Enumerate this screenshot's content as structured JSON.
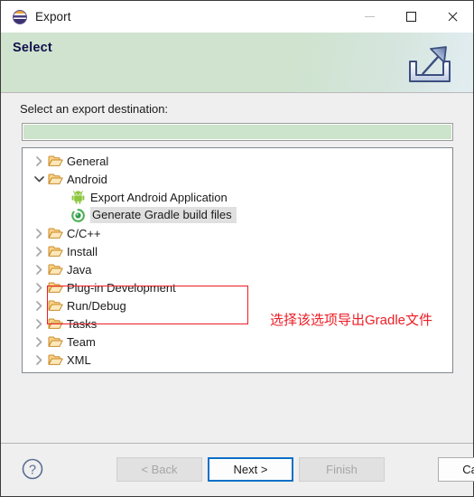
{
  "window": {
    "title": "Export",
    "app_icon": "eclipse-icon",
    "controls": {
      "minimize": "minimize-icon",
      "maximize": "maximize-icon",
      "close": "close-icon"
    }
  },
  "banner": {
    "title": "Select",
    "icon": "export-arrow-icon",
    "background_color": "#cfe3cf"
  },
  "main": {
    "prompt": "Select an export destination:",
    "filter": {
      "value": "",
      "placeholder": "",
      "background_color": "#cce3cc"
    }
  },
  "tree": {
    "items": [
      {
        "label": "General",
        "level": 1,
        "twisty": "chevron-right-icon",
        "icon": "folder-icon",
        "selected": false
      },
      {
        "label": "Android",
        "level": 1,
        "twisty": "chevron-down-icon",
        "icon": "folder-icon",
        "selected": false
      },
      {
        "label": "Export Android Application",
        "level": 2,
        "twisty": "none",
        "icon": "android-icon",
        "selected": false
      },
      {
        "label": "Generate Gradle build files",
        "level": 2,
        "twisty": "none",
        "icon": "gradle-icon",
        "selected": true
      },
      {
        "label": "C/C++",
        "level": 1,
        "twisty": "chevron-right-icon",
        "icon": "folder-icon",
        "selected": false
      },
      {
        "label": "Install",
        "level": 1,
        "twisty": "chevron-right-icon",
        "icon": "folder-icon",
        "selected": false
      },
      {
        "label": "Java",
        "level": 1,
        "twisty": "chevron-right-icon",
        "icon": "folder-icon",
        "selected": false
      },
      {
        "label": "Plug-in Development",
        "level": 1,
        "twisty": "chevron-right-icon",
        "icon": "folder-icon",
        "selected": false
      },
      {
        "label": "Run/Debug",
        "level": 1,
        "twisty": "chevron-right-icon",
        "icon": "folder-icon",
        "selected": false
      },
      {
        "label": "Tasks",
        "level": 1,
        "twisty": "chevron-right-icon",
        "icon": "folder-icon",
        "selected": false
      },
      {
        "label": "Team",
        "level": 1,
        "twisty": "chevron-right-icon",
        "icon": "folder-icon",
        "selected": false
      },
      {
        "label": "XML",
        "level": 1,
        "twisty": "chevron-right-icon",
        "icon": "folder-icon",
        "selected": false
      }
    ]
  },
  "annotations": {
    "highlight_color": "#ee1c25",
    "note": "选择该选项导出Gradle文件"
  },
  "footer": {
    "help": "help-icon",
    "buttons": [
      {
        "label": "< Back",
        "state": "disabled"
      },
      {
        "label": "Next >",
        "state": "focused"
      },
      {
        "label": "Finish",
        "state": "disabled"
      },
      {
        "label": "Cancel",
        "state": "enabled"
      }
    ]
  }
}
